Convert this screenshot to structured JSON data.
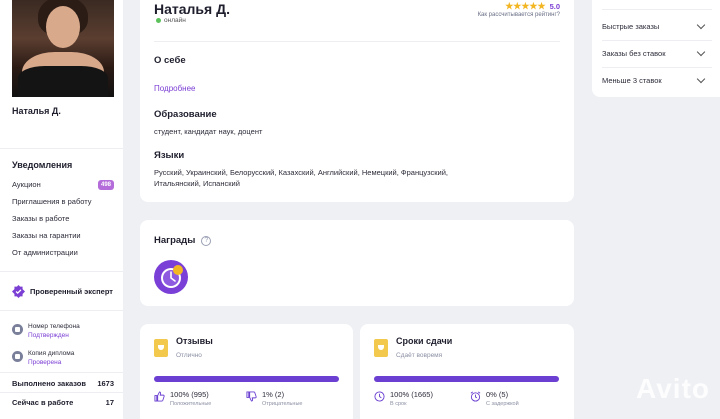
{
  "left": {
    "name": "Наталья Д.",
    "notifications_title": "Уведомления",
    "notifications": [
      {
        "label": "Аукцион",
        "badge": "498"
      },
      {
        "label": "Приглашения в работу"
      },
      {
        "label": "Заказы в работе"
      },
      {
        "label": "Заказы на гарантии"
      },
      {
        "label": "От администрации"
      }
    ],
    "expert_label": "Проверенный эксперт",
    "phone_label": "Номер телефона",
    "phone_status": "Подтвержден",
    "diploma_label": "Копия диплома",
    "diploma_status": "Проверена",
    "completed_label": "Выполнено заказов",
    "completed_value": "1673",
    "now_label": "Сейчас в работе",
    "now_value": "17"
  },
  "profile": {
    "name": "Наталья Д.",
    "status": "онлайн",
    "stars": "★★★★★",
    "rating": "5.0",
    "rating_link": "Как рассчитывается рейтинг?",
    "about_title": "О себе",
    "more_link": "Подробнее",
    "education_title": "Образование",
    "education_text": "студент, кандидат наук, доцент",
    "languages_title": "Языки",
    "languages_text": "Русский, Украинский, Белорусский, Казахский, Английский, Немецкий, Французский, Итальянский, Испанский"
  },
  "awards": {
    "title": "Награды",
    "help": "?"
  },
  "reviews": {
    "title": "Отзывы",
    "subtitle": "Отлично",
    "positive_value": "100% (995)",
    "positive_label": "Положительные",
    "negative_value": "1% (2)",
    "negative_label": "Отрицательные",
    "bar_fill": 1.0
  },
  "deadlines": {
    "title": "Сроки сдачи",
    "subtitle": "Сдаёт вовремя",
    "ontime_value": "100% (1665)",
    "ontime_label": "В срок",
    "late_value": "0% (5)",
    "late_label": "С задержкой",
    "bar_fill": 1.0
  },
  "filters": {
    "items": [
      {
        "label": "Быстрые заказы"
      },
      {
        "label": "Заказы без ставок"
      },
      {
        "label": "Меньше 3 ставок"
      }
    ]
  },
  "watermark": "Avito",
  "colors": {
    "accent": "#7b3fd4",
    "bar": "#6a3fd1",
    "star": "#f3b623",
    "online": "#5bc15b",
    "badge": "#b36cd9"
  }
}
